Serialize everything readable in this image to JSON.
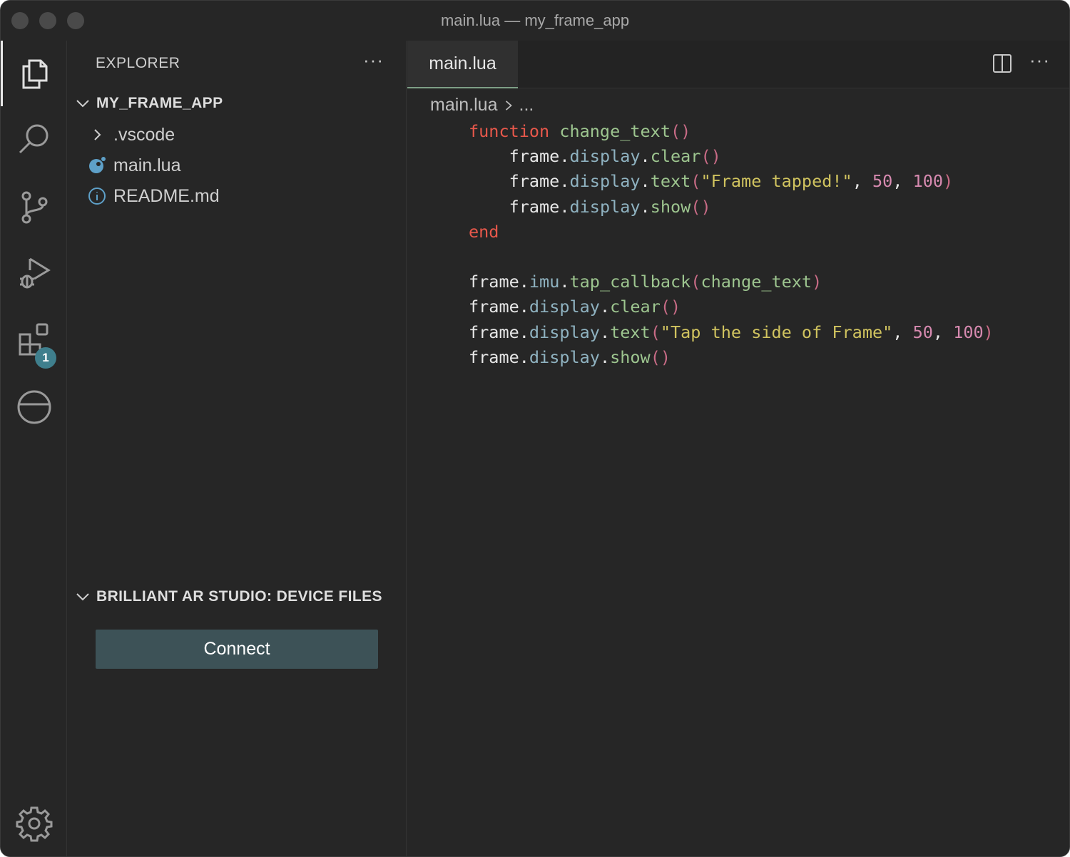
{
  "window": {
    "title": "main.lua — my_frame_app"
  },
  "activity": {
    "extensions_badge": "1"
  },
  "sidebar": {
    "header": "EXPLORER",
    "more": "···",
    "project": "MY_FRAME_APP",
    "files": [
      {
        "name": ".vscode",
        "icon": "chevron-right-icon"
      },
      {
        "name": "main.lua",
        "icon": "lua-file-icon"
      },
      {
        "name": "README.md",
        "icon": "info-icon"
      }
    ],
    "device_section": "BRILLIANT AR STUDIO: DEVICE FILES",
    "connect_label": "Connect"
  },
  "editor": {
    "tab": "main.lua",
    "more": "···",
    "breadcrumb_file": "main.lua",
    "breadcrumb_rest": "...",
    "code_lines": [
      "function change_text()",
      "    frame.display.clear()",
      "    frame.display.text(\"Frame tapped!\", 50, 100)",
      "    frame.display.show()",
      "end",
      "",
      "frame.imu.tap_callback(change_text)",
      "frame.display.clear()",
      "frame.display.text(\"Tap the side of Frame\", 50, 100)",
      "frame.display.show()"
    ]
  },
  "colors": {
    "background": "#262626",
    "keyword": "#e8584b",
    "function": "#9dc58f",
    "property": "#8fb2c0",
    "string": "#d0c35f",
    "number": "#d78ab0",
    "button": "#3d5257",
    "tab_underline": "#7e9f86"
  }
}
